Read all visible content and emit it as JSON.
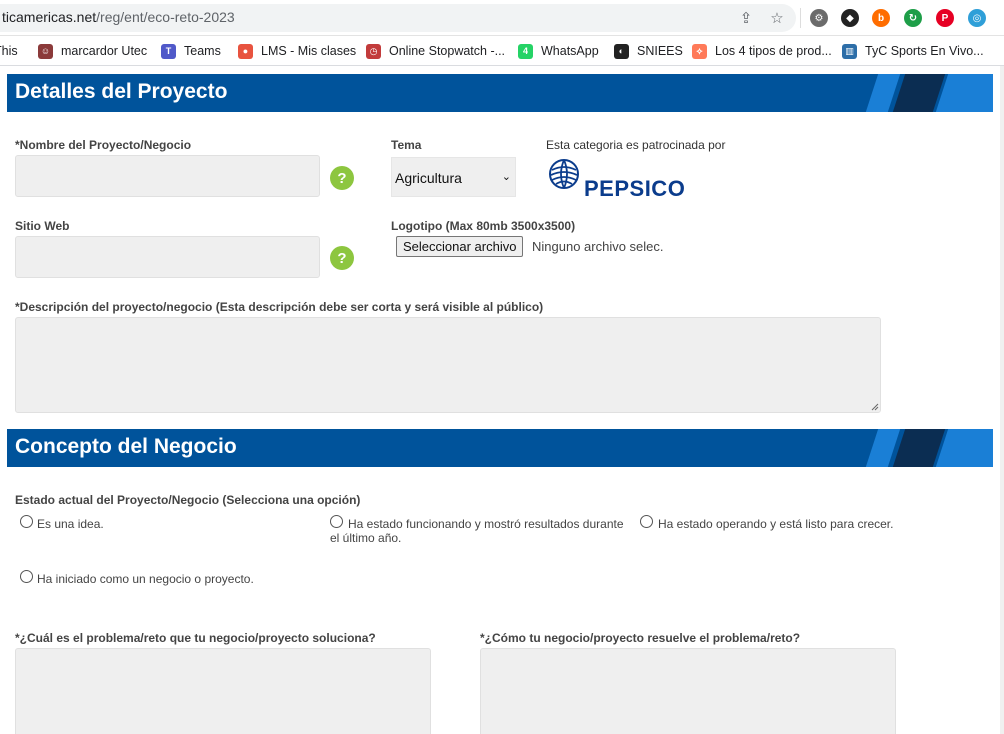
{
  "browser": {
    "url_host": "ticamericas.net",
    "url_path": "/reg/ent/eco-reto-2023",
    "share_icon": "share-icon",
    "star_icon": "star-icon",
    "extensions": [
      {
        "name": "extension-gear-icon",
        "color": "#6b6b6b",
        "glyph": "⚙"
      },
      {
        "name": "extension-owl-icon",
        "color": "#222222",
        "glyph": "◆"
      },
      {
        "name": "extension-b-icon",
        "color": "#ff6d00",
        "glyph": "b"
      },
      {
        "name": "extension-refresh-icon",
        "color": "#1e9e48",
        "glyph": "↻"
      },
      {
        "name": "extension-pinterest-icon",
        "color": "#e60023",
        "glyph": "P"
      },
      {
        "name": "extension-circle-icon",
        "color": "#2f9fd8",
        "glyph": "◎"
      }
    ]
  },
  "bookmarks": [
    {
      "label": "This",
      "color": "#ffffff",
      "glyph": ""
    },
    {
      "label": "marcardor Utec",
      "color": "#8b3a3a",
      "glyph": "☺"
    },
    {
      "label": "Teams",
      "color": "#5059c9",
      "glyph": "T"
    },
    {
      "label": "LMS - Mis clases",
      "color": "#e8533f",
      "glyph": "●"
    },
    {
      "label": "Online Stopwatch -...",
      "color": "#c23b3b",
      "glyph": "◷"
    },
    {
      "label": "WhatsApp",
      "color": "#25d366",
      "glyph": "4"
    },
    {
      "label": "SNIEES",
      "color": "#222222",
      "glyph": "◐"
    },
    {
      "label": "Los 4 tipos de prod...",
      "color": "#ff7a59",
      "glyph": "⟡"
    },
    {
      "label": "TyC Sports En Vivo...",
      "color": "#2d6ea8",
      "glyph": "▥"
    }
  ],
  "section_project": {
    "title": "Detalles del Proyecto",
    "name_label": "*Nombre del Proyecto/Negocio",
    "name_value": "",
    "theme_label": "Tema",
    "theme_selected": "Agricultura",
    "sponsor_label": "Esta categoria es patrocinada por",
    "sponsor_name": "PEPSICO",
    "website_label": "Sitio Web",
    "website_value": "",
    "logo_label": "Logotipo (Max 80mb 3500x3500)",
    "file_button": "Seleccionar archivo",
    "file_status": "Ninguno archivo selec.",
    "description_label": "*Descripción del proyecto/negocio (Esta descripción debe ser corta y será visible al público)",
    "description_value": "",
    "help_glyph": "?"
  },
  "section_concept": {
    "title": "Concepto del Negocio",
    "status_label": "Estado actual del Proyecto/Negocio (Selecciona una opción)",
    "options": [
      "Es una idea.",
      "Ha estado funcionando y mostró resultados durante el último año.",
      "Ha estado operando y está listo para crecer.",
      "Ha iniciado como un negocio o proyecto."
    ],
    "problem_label": "*¿Cuál es el problema/reto que tu negocio/proyecto soluciona?",
    "solution_label": "*¿Cómo tu negocio/proyecto resuelve el problema/reto?"
  },
  "colors": {
    "section_bar": "#00539b",
    "stripe_light": "#1a7fd6",
    "stripe_dark": "#0b2d52",
    "help_green": "#8dc63f"
  }
}
